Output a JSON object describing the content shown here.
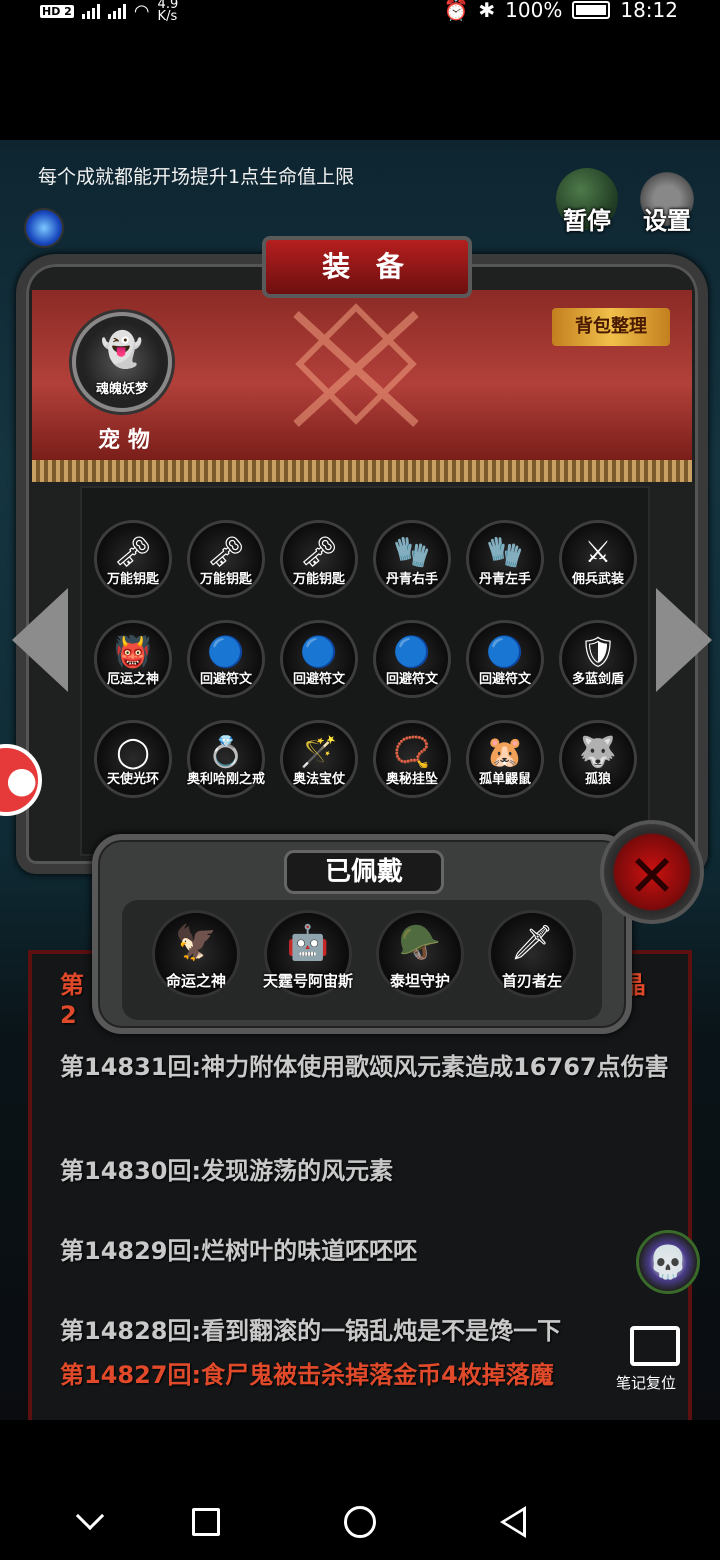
{
  "status_bar": {
    "network_speed": "4.9\nK/s",
    "battery": "100%",
    "time": "18:12"
  },
  "game": {
    "tip": "每个成就都能开场提升1点生命值上限",
    "pause_label": "暂停",
    "settings_label": "设置"
  },
  "equipment": {
    "title": "装 备",
    "sort_label": "背包整理",
    "pet_name": "魂魄妖梦",
    "pet_label": "宠 物",
    "items": [
      {
        "name": "万能钥匙",
        "icon": "key-icon",
        "glyph": "🗝"
      },
      {
        "name": "万能钥匙",
        "icon": "key-icon",
        "glyph": "🗝"
      },
      {
        "name": "万能钥匙",
        "icon": "key-icon",
        "glyph": "🗝"
      },
      {
        "name": "丹青右手",
        "icon": "glove-icon",
        "glyph": "🧤"
      },
      {
        "name": "丹青左手",
        "icon": "glove-icon",
        "glyph": "🧤"
      },
      {
        "name": "佣兵武装",
        "icon": "armor-icon",
        "glyph": "⚔"
      },
      {
        "name": "厄运之神",
        "icon": "demon-icon",
        "glyph": "👹"
      },
      {
        "name": "回避符文",
        "icon": "rune-icon",
        "glyph": "🔵"
      },
      {
        "name": "回避符文",
        "icon": "rune-icon",
        "glyph": "🔵"
      },
      {
        "name": "回避符文",
        "icon": "rune-icon",
        "glyph": "🔵"
      },
      {
        "name": "回避符文",
        "icon": "rune-icon",
        "glyph": "🔵"
      },
      {
        "name": "多蓝剑盾",
        "icon": "shield-icon",
        "glyph": "🛡"
      },
      {
        "name": "天使光环",
        "icon": "halo-icon",
        "glyph": "◯"
      },
      {
        "name": "奥利哈刚之戒",
        "icon": "ring-icon",
        "glyph": "💍"
      },
      {
        "name": "奥法宝仗",
        "icon": "staff-icon",
        "glyph": "🪄"
      },
      {
        "name": "奥秘挂坠",
        "icon": "pendant-icon",
        "glyph": "📿"
      },
      {
        "name": "孤单鼹鼠",
        "icon": "mole-icon",
        "glyph": "🐹"
      },
      {
        "name": "孤狼",
        "icon": "wolf-icon",
        "glyph": "🐺"
      }
    ]
  },
  "worn": {
    "title": "已佩戴",
    "items": [
      {
        "name": "命运之神",
        "icon": "fate-bird-icon",
        "glyph": "🦅"
      },
      {
        "name": "天霆号阿宙斯",
        "icon": "mech-icon",
        "glyph": "🤖"
      },
      {
        "name": "泰坦守护",
        "icon": "titan-helm-icon",
        "glyph": "🪖"
      },
      {
        "name": "首刃者左",
        "icon": "blade-icon",
        "glyph": "🗡"
      }
    ]
  },
  "log": {
    "partial_top_left": "第",
    "partial_top_left2": "2",
    "partial_top_right": "晶",
    "lines": [
      "第14831回:神力附体使用歌颂风元素造成16767点伤害",
      "第14830回:发现游荡的风元素",
      "第14829回:烂树叶的味道呸呸呸",
      "第14828回:看到翻滚的一锅乱炖是不是馋一下",
      "第14827回:食尸鬼被击杀掉落金币4枚掉落魔"
    ]
  },
  "notes_label": "笔记复位"
}
